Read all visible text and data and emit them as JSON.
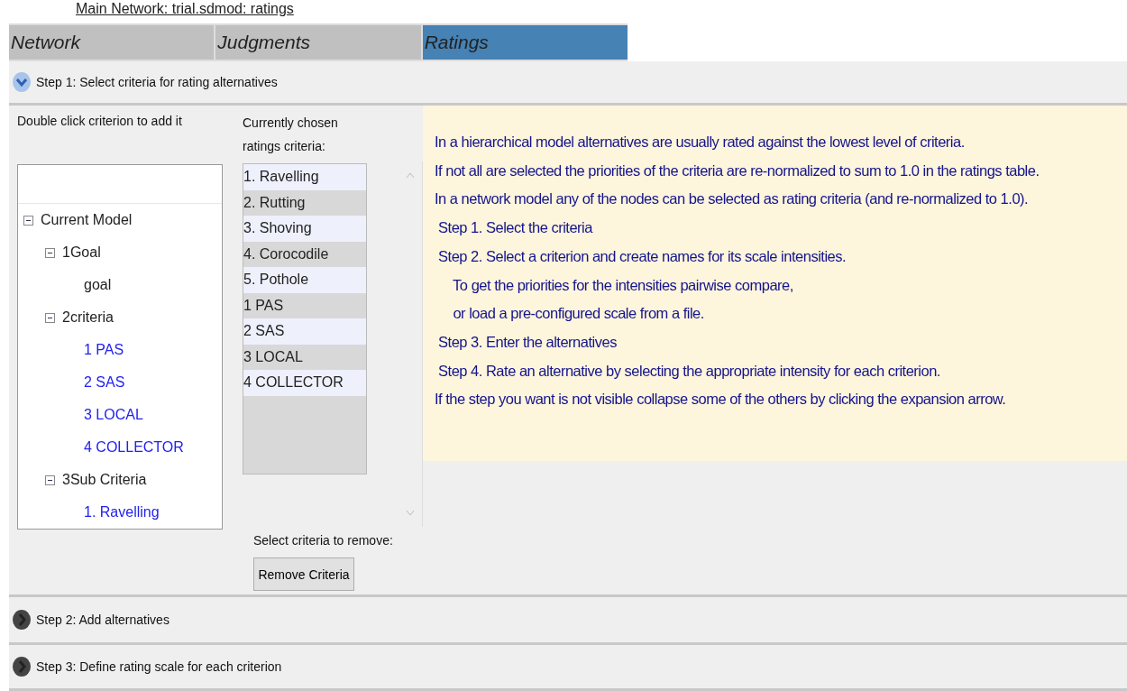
{
  "window": {
    "title": "Main Network: trial.sdmod: ratings"
  },
  "tabs": [
    {
      "label": "Network",
      "selected": false
    },
    {
      "label": "Judgments",
      "selected": false
    },
    {
      "label": "Ratings",
      "selected": true
    }
  ],
  "steps": [
    {
      "title": "Step 1: Select criteria for rating alternatives",
      "expanded": true
    },
    {
      "title": "Step 2: Add alternatives",
      "expanded": false
    },
    {
      "title": "Step 3: Define rating scale for each criterion",
      "expanded": false
    }
  ],
  "tree_panel": {
    "label": "Double click criterion to add it",
    "tree": [
      {
        "label": "Current Model",
        "expanded": true,
        "chosen": false,
        "children": [
          {
            "label": "1Goal",
            "expanded": true,
            "chosen": false,
            "children": [
              {
                "label": "goal",
                "chosen": false
              }
            ]
          },
          {
            "label": "2criteria",
            "expanded": true,
            "chosen": false,
            "children": [
              {
                "label": "1 PAS",
                "chosen": true
              },
              {
                "label": "2 SAS",
                "chosen": true
              },
              {
                "label": "3 LOCAL",
                "chosen": true
              },
              {
                "label": "4 COLLECTOR",
                "chosen": true
              }
            ]
          },
          {
            "label": "3Sub Criteria",
            "expanded": true,
            "chosen": false,
            "children": [
              {
                "label": "1. Ravelling",
                "chosen": true
              }
            ]
          }
        ]
      }
    ]
  },
  "chosen_panel": {
    "label": "Currently chosen ratings criteria:",
    "items": [
      "1. Ravelling",
      "2. Rutting",
      "3. Shoving",
      "4. Corocodile",
      "5. Pothole",
      "1 PAS",
      "2 SAS",
      "3 LOCAL",
      "4 COLLECTOR"
    ],
    "remove_label": "Select criteria to remove:",
    "remove_button": "Remove Criteria"
  },
  "instructions": [
    "In a hierarchical model alternatives are usually rated against the lowest level of criteria.",
    "If not all are selected the priorities of the criteria are re-normalized to sum to 1.0 in the ratings table.",
    "In a network model any of the nodes can be selected as rating criteria (and re-normalized to 1.0).",
    " Step 1. Select the criteria",
    " Step 2. Select a criterion and create names for its scale intensities.",
    "     To get the priorities for the intensities pairwise compare,",
    "     or load a pre-configured scale from a file.",
    " Step 3. Enter the alternatives",
    " Step 4. Rate an alternative by selecting the appropriate intensity for each criterion.",
    "If the step you want is not visible collapse some of the others by clicking the expansion arrow."
  ]
}
